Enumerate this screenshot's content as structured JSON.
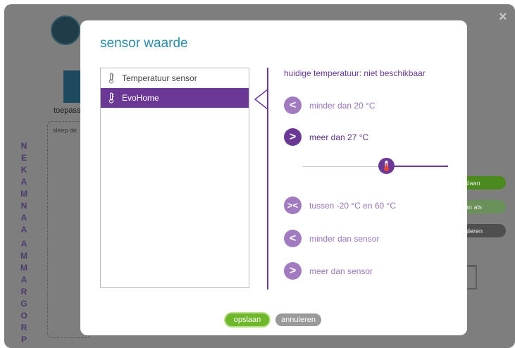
{
  "background": {
    "app_label": "toepass",
    "panel_hint": "sleep de",
    "vertical_title": [
      "P",
      "R",
      "O",
      "G",
      "R",
      "A",
      "M",
      "M",
      "A",
      "",
      "A",
      "A",
      "N",
      "M",
      "A",
      "K",
      "E",
      "N"
    ],
    "pills": [
      {
        "label": "slaan",
        "color": "#4a8a1f"
      },
      {
        "label": "an als",
        "color": "#6a915a"
      },
      {
        "label": "uleren",
        "color": "#4f4f4f"
      }
    ]
  },
  "dialog": {
    "title": "sensor waarde",
    "sensors": [
      {
        "label": "Temperatuur sensor",
        "selected": false
      },
      {
        "label": "EvoHome",
        "selected": true
      }
    ],
    "current_temperature": "huidige temperatuur: niet beschikbaar",
    "options": [
      {
        "icon": "<",
        "label": "minder dan 20 °C",
        "active": false
      },
      {
        "icon": ">",
        "label": "meer dan 27 °C",
        "active": true
      },
      {
        "icon": "><",
        "label": "tussen -20 °C en 60 °C",
        "active": false
      },
      {
        "icon": "<",
        "label": "minder dan sensor",
        "active": false
      },
      {
        "icon": ">",
        "label": "meer dan sensor",
        "active": false
      }
    ],
    "slider_position": 0.58,
    "save_label": "opslaan",
    "cancel_label": "annuleren"
  },
  "colors": {
    "accent": "#6b3895",
    "title": "#2b8da5",
    "save": "#6fb82b",
    "cancel": "#9a9a9a"
  }
}
